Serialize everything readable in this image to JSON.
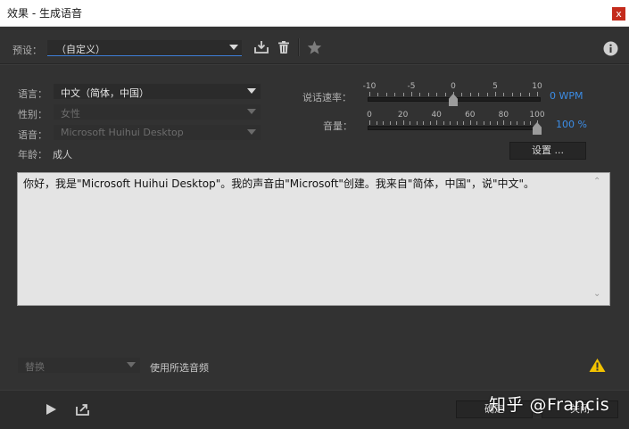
{
  "window": {
    "title": "效果 - 生成语音",
    "close_glyph": "x"
  },
  "preset": {
    "label": "预设：",
    "value": "（自定义）"
  },
  "icons": {
    "save": "save-preset-icon",
    "delete": "trash-icon",
    "favorite": "star-icon",
    "info": "info-icon",
    "warning": "warning-icon",
    "play": "play-icon",
    "export": "export-icon"
  },
  "voice": {
    "language_label": "语言：",
    "language_value": "中文（简体，中国）",
    "gender_label": "性别：",
    "gender_value": "女性",
    "voice_label": "语音：",
    "voice_value": "Microsoft Huihui Desktop",
    "age_label": "年龄：",
    "age_value": "成人"
  },
  "speech_rate": {
    "label": "说话速率：",
    "ticks": [
      "-10",
      "-5",
      "0",
      "5",
      "10"
    ],
    "value": 0,
    "min": -10,
    "max": 10,
    "readout": "0 WPM"
  },
  "volume": {
    "label": "音量：",
    "ticks": [
      "0",
      "20",
      "40",
      "60",
      "80",
      "100"
    ],
    "value": 100,
    "min": 0,
    "max": 100,
    "readout": "100 %"
  },
  "settings_button": "设置 ...",
  "text_content": "你好，我是\"Microsoft Huihui Desktop\"。我的声音由\"Microsoft\"创建。我来自\"简体，中国\"，说\"中文\"。",
  "footer": {
    "replace_value": "替换",
    "use_selected_label": "使用所选音频",
    "ok_button": "确定",
    "close_button": "关闭"
  },
  "watermark": "知乎 @Francis",
  "colors": {
    "accent_blue": "#3c8de6",
    "background": "#323232",
    "warning": "#f2c200"
  }
}
